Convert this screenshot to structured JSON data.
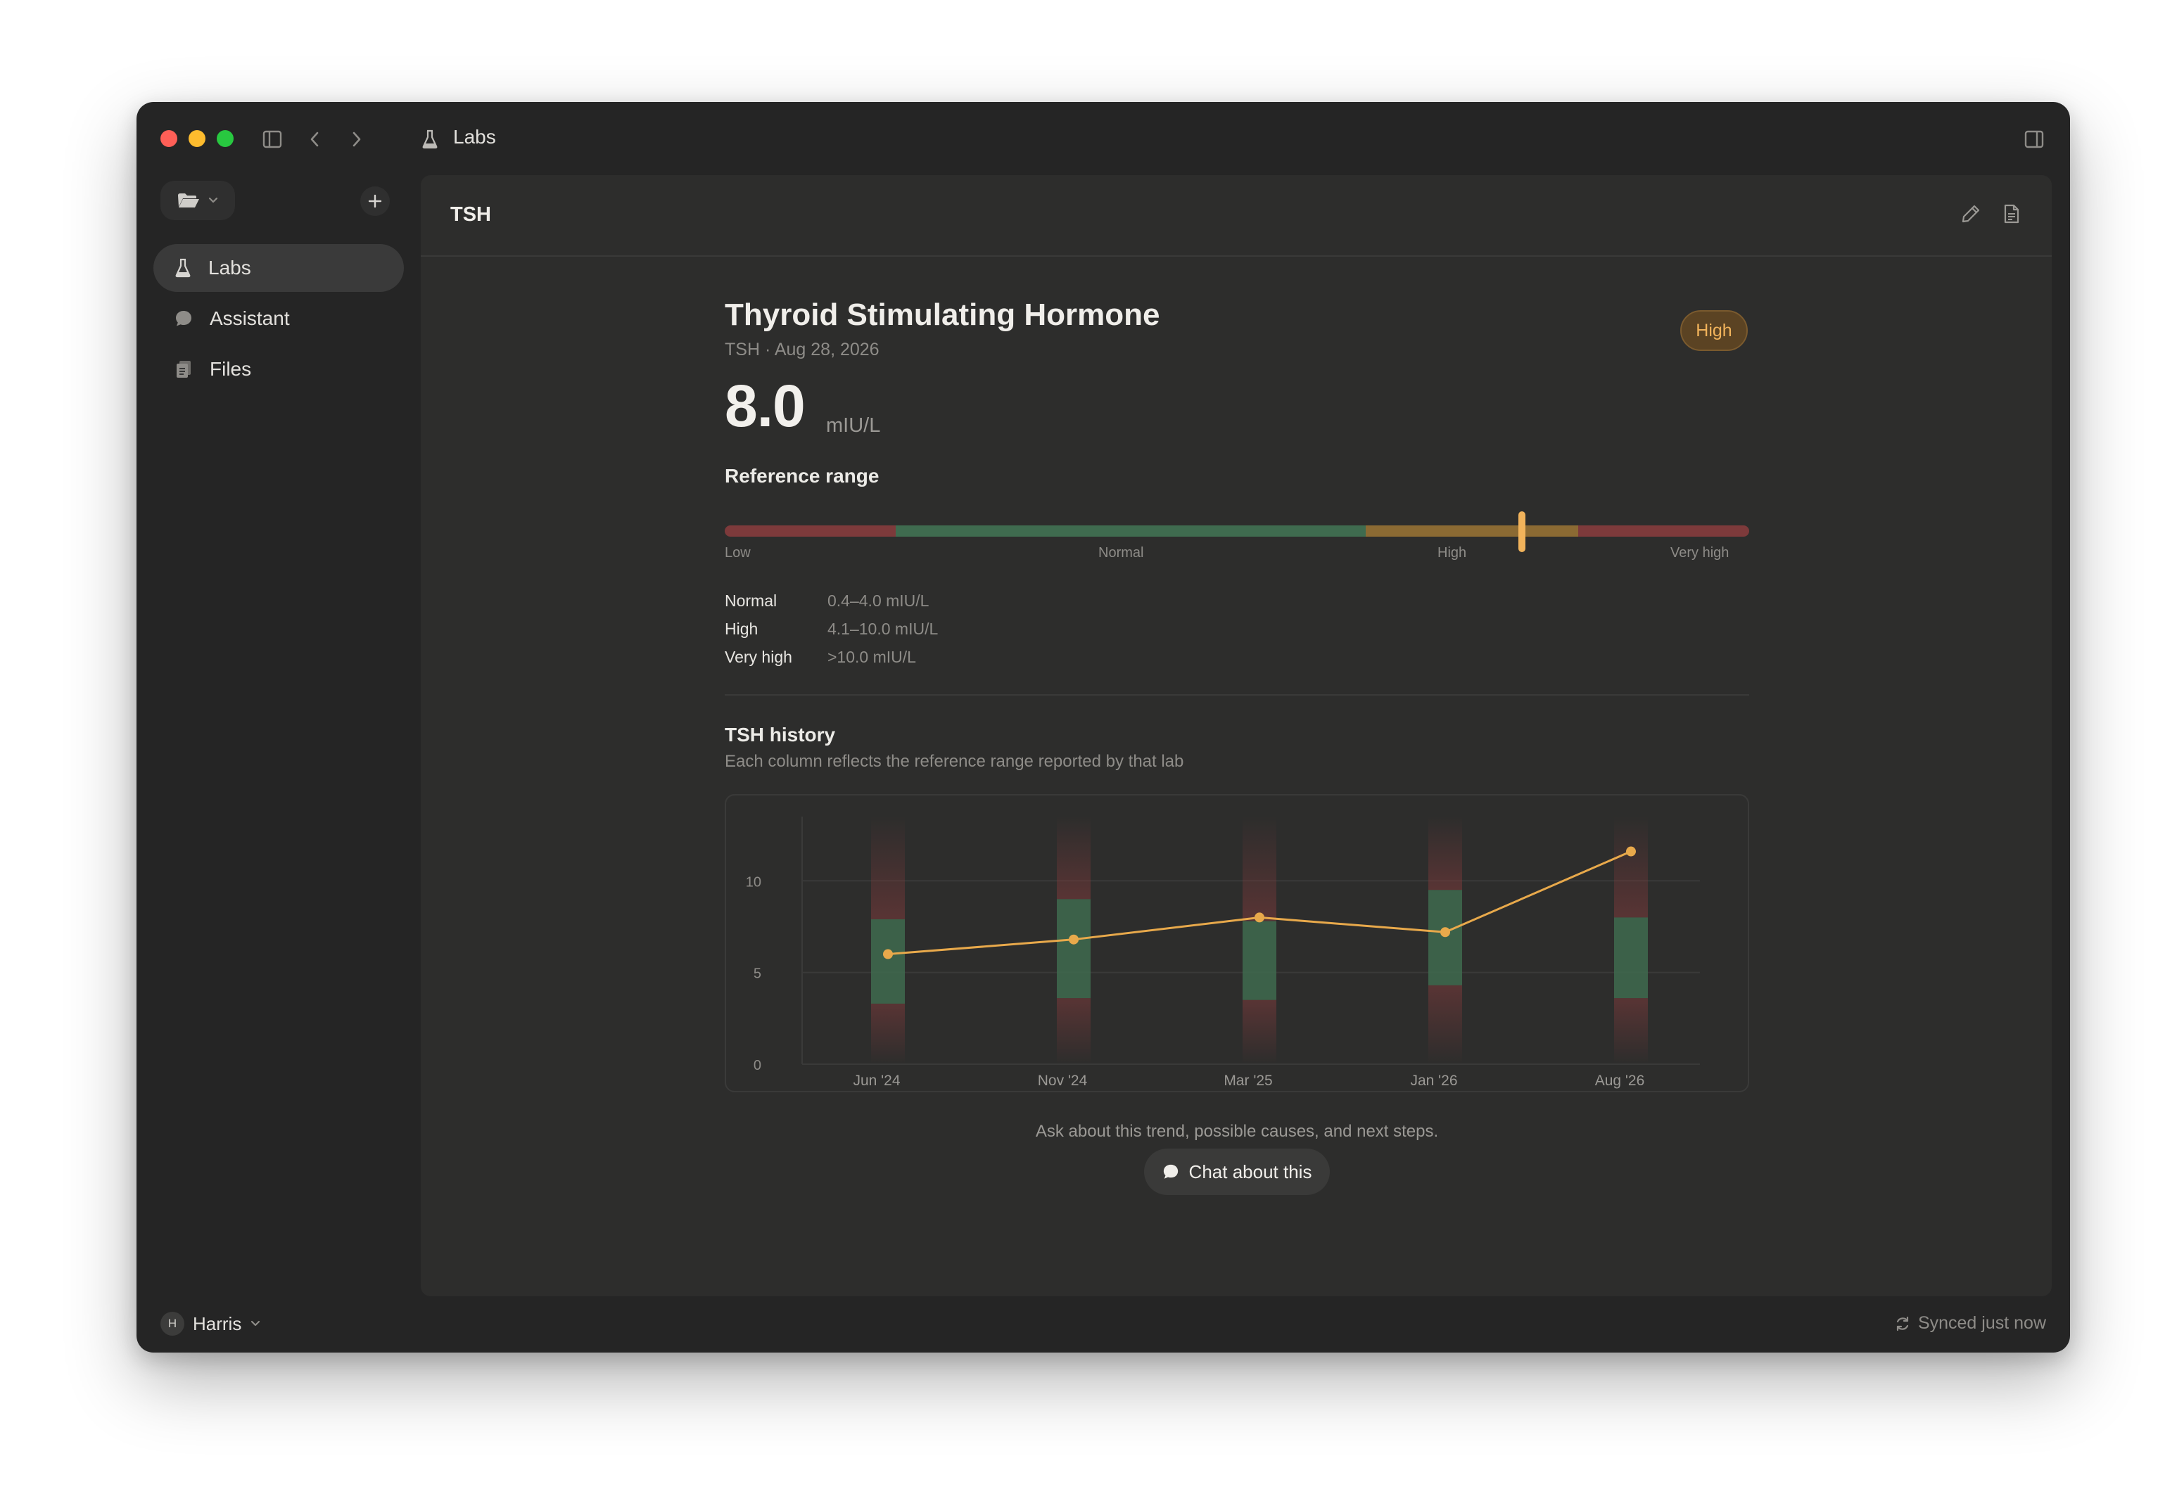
{
  "app": {
    "title": "Labs"
  },
  "sidebar": {
    "items": [
      {
        "label": "Labs",
        "icon": "flask-icon",
        "active": true
      },
      {
        "label": "Assistant",
        "icon": "chat-bubble-icon",
        "active": false
      },
      {
        "label": "Files",
        "icon": "files-icon",
        "active": false
      }
    ],
    "user": {
      "initial": "H",
      "name": "Harris"
    },
    "sync_status": "Synced just now"
  },
  "page": {
    "tab_title": "TSH",
    "heading": "Thyroid Stimulating Hormone",
    "subtitle": "TSH · Aug 28, 2026",
    "status_badge": "High",
    "value": "8.0",
    "unit": "mIU/L",
    "reference_title": "Reference range",
    "range_bar": {
      "labels": [
        "Low",
        "Normal",
        "High",
        "Very high"
      ],
      "marker_fraction": 0.778,
      "segments": [
        {
          "name": "low",
          "from": 0.0,
          "to": 0.167,
          "color": "#7d3a3b"
        },
        {
          "name": "normal",
          "from": 0.167,
          "to": 0.626,
          "color": "#3f6b4f"
        },
        {
          "name": "high",
          "from": 0.626,
          "to": 0.833,
          "color": "#8b6a33"
        },
        {
          "name": "very-high",
          "from": 0.833,
          "to": 1.0,
          "color": "#7d3a3b"
        }
      ],
      "marker_color": "#f1b35b"
    },
    "reference_table": [
      {
        "name": "Normal",
        "value": "0.4–4.0 mIU/L"
      },
      {
        "name": "High",
        "value": "4.1–10.0 mIU/L"
      },
      {
        "name": "Very high",
        "value": ">10.0 mIU/L"
      }
    ],
    "history_title": "TSH history",
    "history_subtitle": "Each column reflects the reference range reported by that lab",
    "ask_text": "Ask about this trend, possible causes, and next steps.",
    "chat_button": "Chat about this"
  },
  "chart_data": {
    "type": "line",
    "categories": [
      "Jun '24",
      "Nov '24",
      "Mar '25",
      "Jan '26",
      "Aug '26"
    ],
    "series": [
      {
        "values": [
          6.0,
          6.8,
          8.0,
          7.2,
          11.6
        ],
        "color": "#e8a94b"
      }
    ],
    "reference_ranges": [
      {
        "normal": [
          3.3,
          7.9
        ]
      },
      {
        "normal": [
          3.6,
          9.0
        ]
      },
      {
        "normal": [
          3.5,
          7.8
        ]
      },
      {
        "normal": [
          4.3,
          9.5
        ]
      },
      {
        "normal": [
          3.6,
          8.0
        ]
      }
    ],
    "yticks": [
      0,
      5,
      10
    ],
    "ylim": [
      0,
      13.5
    ],
    "grid": true,
    "xlabel": "",
    "ylabel": ""
  },
  "colors": {
    "accent": "#f1b35b",
    "normal_band": "#3f6b4f",
    "abnormal_band": "#7d3a3b",
    "line": "#e8a94b"
  }
}
